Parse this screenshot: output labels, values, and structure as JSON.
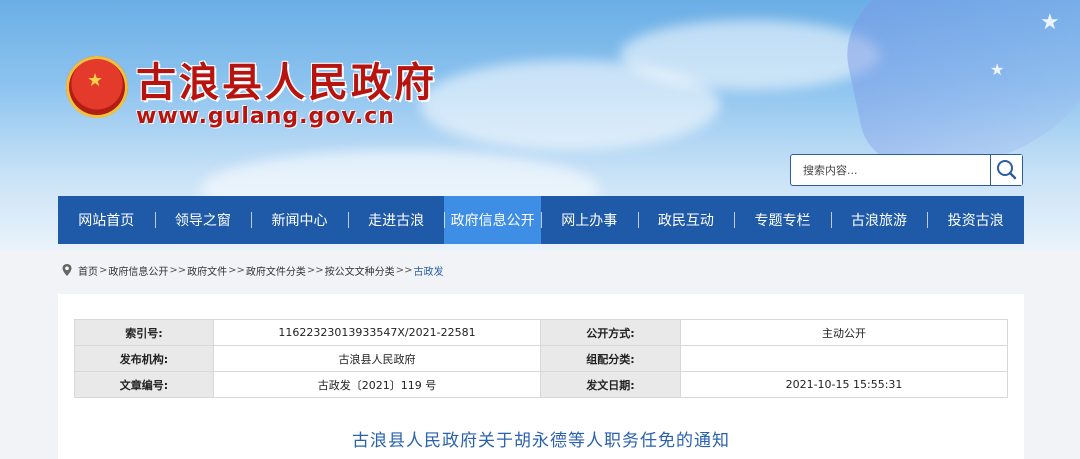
{
  "site": {
    "title": "古浪县人民政府",
    "url": "www.gulang.gov.cn"
  },
  "search": {
    "placeholder": "搜索内容..."
  },
  "nav": {
    "items": [
      "网站首页",
      "领导之窗",
      "新闻中心",
      "走进古浪",
      "政府信息公开",
      "网上办事",
      "政民互动",
      "专题专栏",
      "古浪旅游",
      "投资古浪"
    ],
    "active": "政府信息公开"
  },
  "breadcrumb": {
    "items": [
      "首页",
      "政府信息公开",
      "政府文件",
      "政府文件分类",
      "按公文文种分类",
      "古政发"
    ],
    "separators": [
      ">",
      ">>",
      ">>",
      ">>",
      ">>"
    ]
  },
  "meta": {
    "rows": [
      {
        "label1": "索引号:",
        "value1": "11622323013933547X/2021-22581",
        "label2": "公开方式:",
        "value2": "主动公开"
      },
      {
        "label1": "发布机构:",
        "value1": "古浪县人民政府",
        "label2": "组配分类:",
        "value2": ""
      },
      {
        "label1": "文章编号:",
        "value1": "古政发〔2021〕119 号",
        "label2": "发文日期:",
        "value2": "2021-10-15 15:55:31"
      }
    ]
  },
  "document": {
    "title": "古浪县人民政府关于胡永德等人职务任免的通知"
  },
  "colors": {
    "nav_bg": "#1e5aa8",
    "nav_active": "#3f8ee6",
    "title_red": "#b8140f",
    "doc_title_blue": "#2a62b0"
  }
}
